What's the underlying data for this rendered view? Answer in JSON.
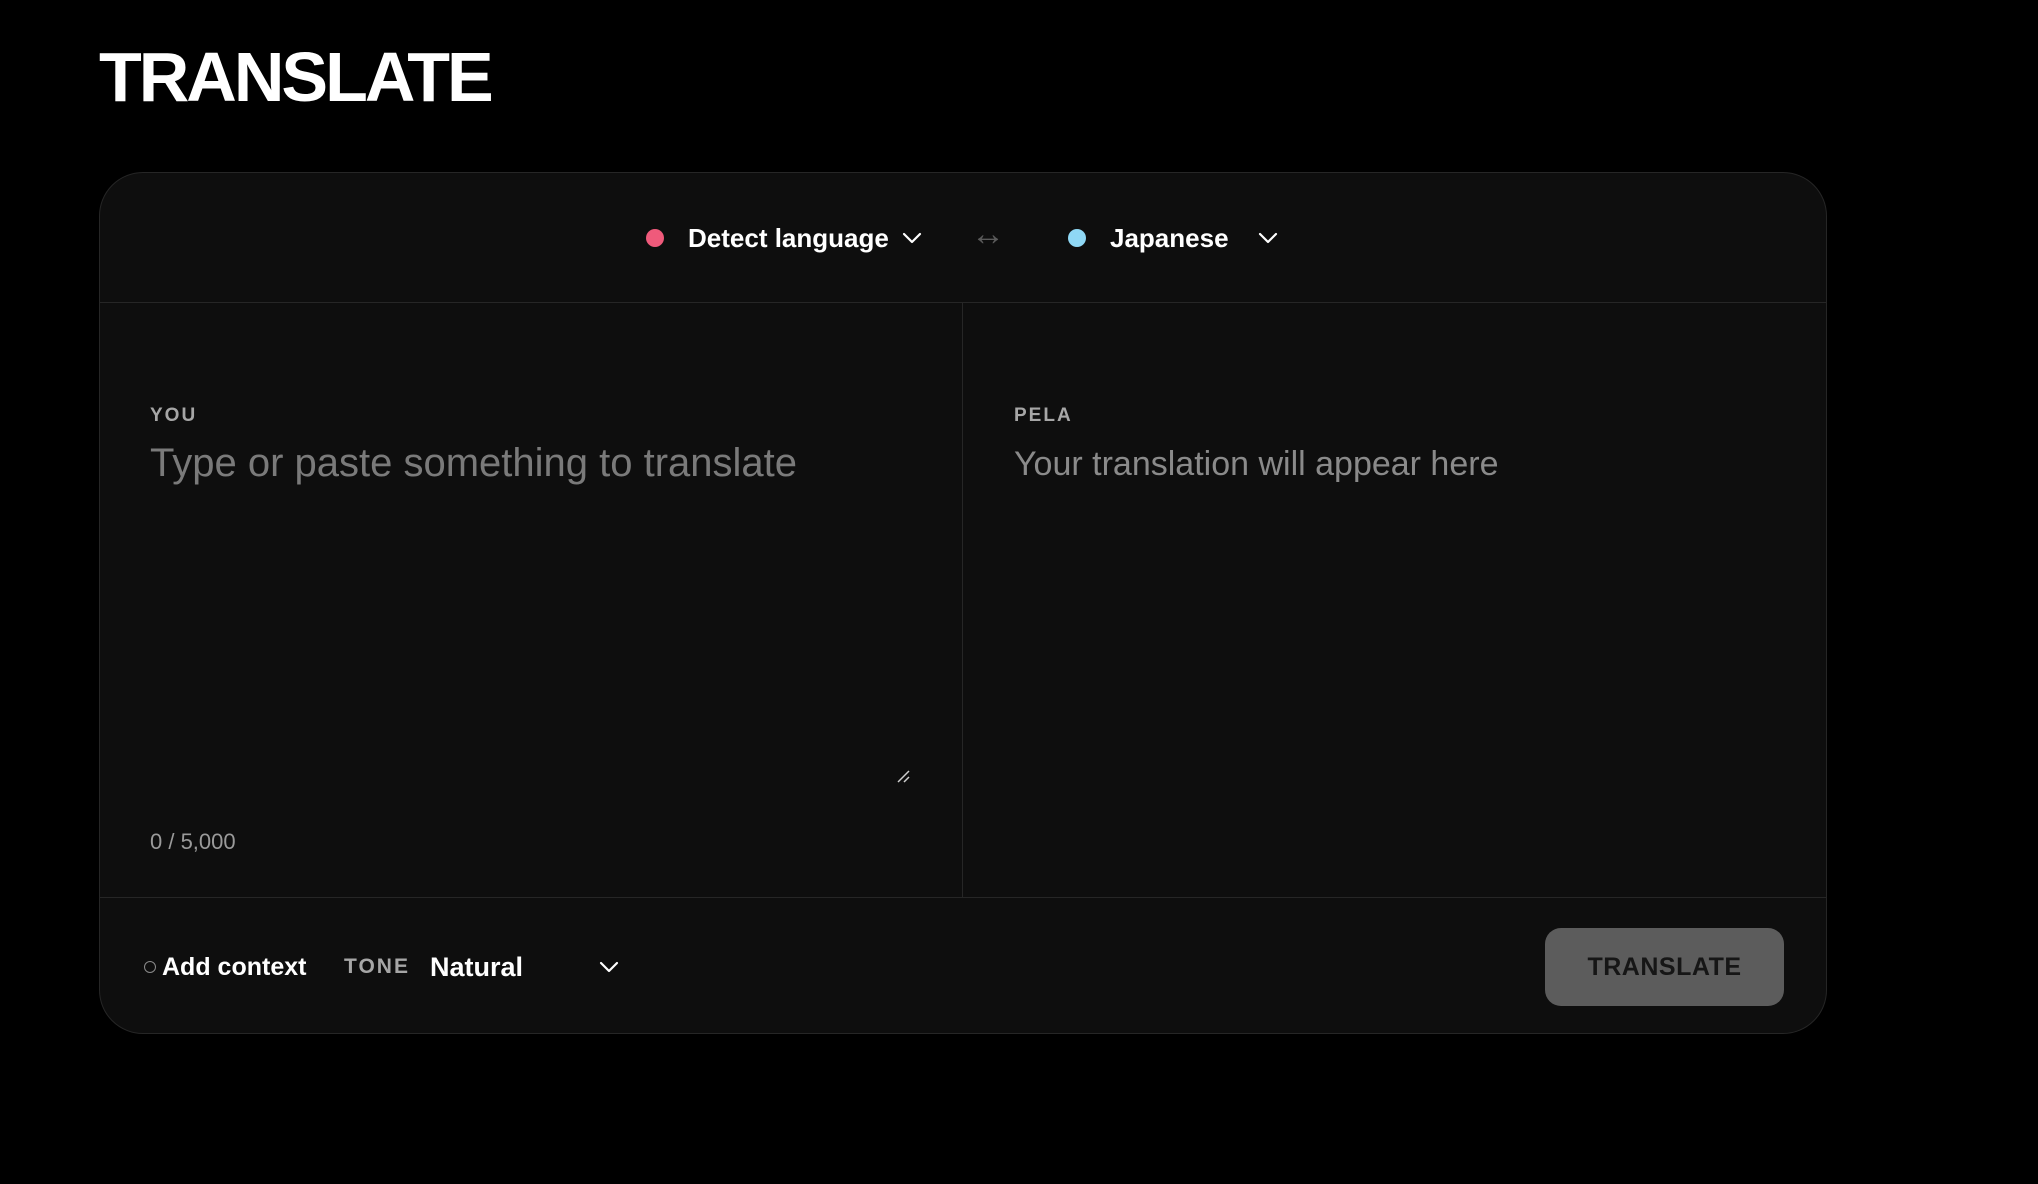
{
  "page": {
    "title": "TRANSLATE"
  },
  "language_bar": {
    "source": {
      "label": "Detect language",
      "dot_color": "#ef5a7b",
      "icon": "chevron-down-icon"
    },
    "swap_icon": "↔",
    "target": {
      "label": "Japanese",
      "dot_color": "#8fd8f5",
      "icon": "chevron-down-icon"
    }
  },
  "source_pane": {
    "label": "YOU",
    "placeholder": "Type or paste something to translate",
    "value": "",
    "char_count": "0 / 5,000"
  },
  "target_pane": {
    "label": "PELA",
    "placeholder": "Your translation will appear here"
  },
  "bottom_bar": {
    "context_label": "Add context",
    "tone_label": "TONE",
    "tone_value": "Natural",
    "translate_button": "TRANSLATE"
  },
  "colors": {
    "background": "#000000",
    "card": "#0e0e0e",
    "button": "#5c5c5c"
  }
}
